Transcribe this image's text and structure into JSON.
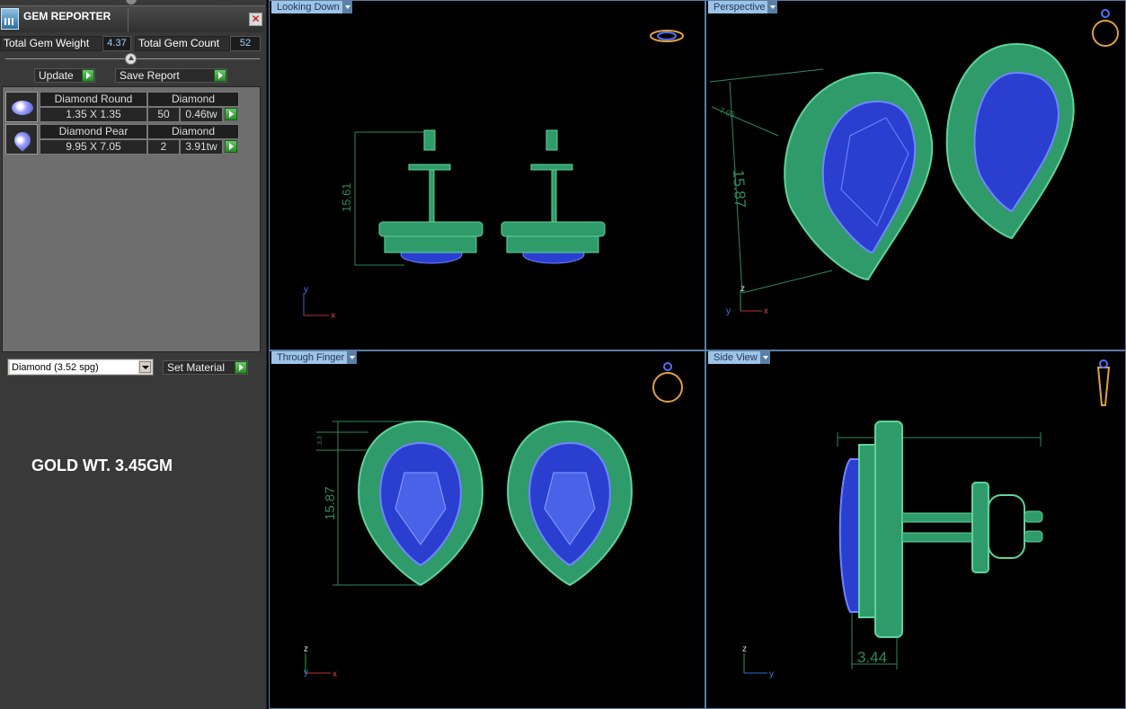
{
  "panel": {
    "title": "GEM REPORTER",
    "close_glyph": "✕",
    "total_weight_label": "Total Gem Weight",
    "total_weight_value": "4.37",
    "total_count_label": "Total Gem Count",
    "total_count_value": "52",
    "update_label": "Update",
    "save_report_label": "Save Report",
    "gems": [
      {
        "shape": "Diamond Round",
        "material": "Diamond",
        "size": "1.35 X 1.35",
        "count": "50",
        "weight": "0.46tw"
      },
      {
        "shape": "Diamond Pear",
        "material": "Diamond",
        "size": "9.95 X 7.05",
        "count": "2",
        "weight": "3.91tw"
      }
    ],
    "material_select": "Diamond      (3.52 spg)",
    "set_material_label": "Set Material",
    "note": "GOLD WT. 3.45GM"
  },
  "viewports": {
    "top_left": {
      "label": "Looking Down",
      "dimension": "15.61",
      "axis_y": "y",
      "axis_x": "x"
    },
    "top_right": {
      "label": "Perspective",
      "dimension": "15.87",
      "dimension_small": "7.05",
      "axis_z": "z",
      "axis_y": "y",
      "axis_x": "x"
    },
    "bottom_left": {
      "label": "Through Finger",
      "dimension": "15.87",
      "dimension_small": "3.3",
      "axis_z": "z",
      "axis_y": "y",
      "axis_x": "x"
    },
    "bottom_right": {
      "label": "Side View",
      "dimension": "3.44",
      "axis_z": "z",
      "axis_y": "y"
    }
  },
  "colors": {
    "metal": "#2f9a6a",
    "metal_light": "#5fd49a",
    "stone": "#2a3fd0",
    "stone_light": "#6f86ff",
    "dimension": "#2e8a5c",
    "ring_icon": "#e0a040",
    "viewport_border": "#5a7ea6"
  }
}
